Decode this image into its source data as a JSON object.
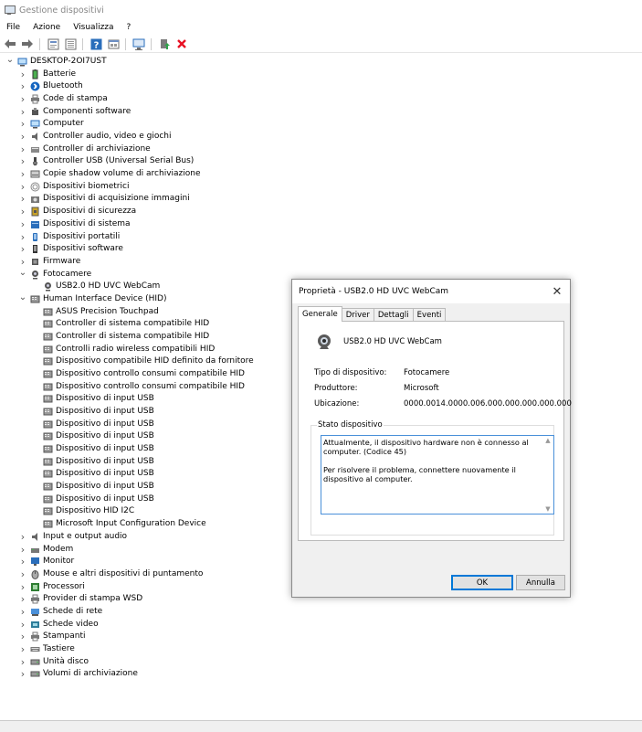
{
  "window": {
    "title": "Gestione dispositivi"
  },
  "menu": [
    "File",
    "Azione",
    "Visualizza",
    "?"
  ],
  "toolbar": [
    {
      "icon": "back-arrow-icon"
    },
    {
      "icon": "forward-arrow-icon"
    },
    {
      "icon": "properties-icon"
    },
    {
      "icon": "properties-sheet-icon"
    },
    {
      "icon": "help-icon"
    },
    {
      "icon": "view-icon"
    },
    {
      "icon": "scan-hardware-icon"
    },
    {
      "icon": "update-driver-icon"
    },
    {
      "icon": "uninstall-icon"
    }
  ],
  "tree": {
    "root": "DESKTOP-2OI7UST",
    "items": [
      {
        "label": "Batterie",
        "icon": "battery-icon",
        "expanded": false
      },
      {
        "label": "Bluetooth",
        "icon": "bluetooth-icon",
        "expanded": false
      },
      {
        "label": "Code di stampa",
        "icon": "printer-icon",
        "expanded": false
      },
      {
        "label": "Componenti software",
        "icon": "puzzle-icon",
        "expanded": false
      },
      {
        "label": "Computer",
        "icon": "computer-icon",
        "expanded": false
      },
      {
        "label": "Controller audio, video e giochi",
        "icon": "speaker-icon",
        "expanded": false
      },
      {
        "label": "Controller di archiviazione",
        "icon": "storage-controller-icon",
        "expanded": false
      },
      {
        "label": "Controller USB (Universal Serial Bus)",
        "icon": "usb-icon",
        "expanded": false
      },
      {
        "label": "Copie shadow volume di archiviazione",
        "icon": "disk-icon",
        "expanded": false
      },
      {
        "label": "Dispositivi biometrici",
        "icon": "fingerprint-icon",
        "expanded": false
      },
      {
        "label": "Dispositivi di acquisizione immagini",
        "icon": "camera-icon",
        "expanded": false
      },
      {
        "label": "Dispositivi di sicurezza",
        "icon": "security-key-icon",
        "expanded": false
      },
      {
        "label": "Dispositivi di sistema",
        "icon": "system-folder-icon",
        "expanded": false
      },
      {
        "label": "Dispositivi portatili",
        "icon": "portable-device-icon",
        "expanded": false
      },
      {
        "label": "Dispositivi software",
        "icon": "software-device-icon",
        "expanded": false
      },
      {
        "label": "Firmware",
        "icon": "chip-icon",
        "expanded": false
      },
      {
        "label": "Fotocamere",
        "icon": "webcam-icon",
        "expanded": true,
        "children": [
          {
            "label": "USB2.0 HD UVC WebCam",
            "icon": "webcam-icon"
          }
        ]
      },
      {
        "label": "Human Interface Device (HID)",
        "icon": "hid-icon",
        "expanded": true,
        "children": [
          {
            "label": "ASUS Precision Touchpad",
            "icon": "hid-icon"
          },
          {
            "label": "Controller di sistema compatibile HID",
            "icon": "hid-icon"
          },
          {
            "label": "Controller di sistema compatibile HID",
            "icon": "hid-icon"
          },
          {
            "label": "Controlli radio wireless compatibili HID",
            "icon": "hid-icon"
          },
          {
            "label": "Dispositivo compatibile HID definito da fornitore",
            "icon": "hid-icon"
          },
          {
            "label": "Dispositivo controllo consumi compatibile HID",
            "icon": "hid-icon"
          },
          {
            "label": "Dispositivo controllo consumi compatibile HID",
            "icon": "hid-icon"
          },
          {
            "label": "Dispositivo di input USB",
            "icon": "hid-icon"
          },
          {
            "label": "Dispositivo di input USB",
            "icon": "hid-icon"
          },
          {
            "label": "Dispositivo di input USB",
            "icon": "hid-icon"
          },
          {
            "label": "Dispositivo di input USB",
            "icon": "hid-icon"
          },
          {
            "label": "Dispositivo di input USB",
            "icon": "hid-icon"
          },
          {
            "label": "Dispositivo di input USB",
            "icon": "hid-icon"
          },
          {
            "label": "Dispositivo di input USB",
            "icon": "hid-icon"
          },
          {
            "label": "Dispositivo di input USB",
            "icon": "hid-icon"
          },
          {
            "label": "Dispositivo di input USB",
            "icon": "hid-icon"
          },
          {
            "label": "Dispositivo HID I2C",
            "icon": "hid-icon"
          },
          {
            "label": "Microsoft Input Configuration Device",
            "icon": "hid-icon"
          }
        ]
      },
      {
        "label": "Input e output audio",
        "icon": "speaker-icon",
        "expanded": false
      },
      {
        "label": "Modem",
        "icon": "modem-icon",
        "expanded": false
      },
      {
        "label": "Monitor",
        "icon": "monitor-icon",
        "expanded": false
      },
      {
        "label": "Mouse e altri dispositivi di puntamento",
        "icon": "mouse-icon",
        "expanded": false
      },
      {
        "label": "Processori",
        "icon": "processor-icon",
        "expanded": false
      },
      {
        "label": "Provider di stampa WSD",
        "icon": "printer-icon",
        "expanded": false
      },
      {
        "label": "Schede di rete",
        "icon": "network-adapter-icon",
        "expanded": false
      },
      {
        "label": "Schede video",
        "icon": "display-adapter-icon",
        "expanded": false
      },
      {
        "label": "Stampanti",
        "icon": "printer-icon",
        "expanded": false
      },
      {
        "label": "Tastiere",
        "icon": "keyboard-icon",
        "expanded": false
      },
      {
        "label": "Unità disco",
        "icon": "disk-drive-icon",
        "expanded": false
      },
      {
        "label": "Volumi di archiviazione",
        "icon": "disk-drive-icon",
        "expanded": false
      }
    ]
  },
  "dialog": {
    "title": "Proprietà - USB2.0 HD UVC WebCam",
    "tabs": [
      "Generale",
      "Driver",
      "Dettagli",
      "Eventi"
    ],
    "active_tab": "Generale",
    "device_name": "USB2.0 HD UVC WebCam",
    "props": [
      {
        "label": "Tipo di dispositivo:",
        "value": "Fotocamere"
      },
      {
        "label": "Produttore:",
        "value": "Microsoft"
      },
      {
        "label": "Ubicazione:",
        "value": "0000.0014.0000.006.000.000.000.000.000"
      }
    ],
    "status_label": "Stato dispositivo",
    "status_text": "Attualmente, il dispositivo hardware non è connesso al computer. (Codice 45)\n\nPer risolvere il problema, connettere nuovamente il dispositivo al computer.",
    "ok_label": "OK",
    "cancel_label": "Annulla"
  },
  "colors": {
    "accent": "#0078d7",
    "bluetooth": "#1565c0",
    "error_red": "#e81123",
    "folder_blue": "#2a6ebb"
  }
}
